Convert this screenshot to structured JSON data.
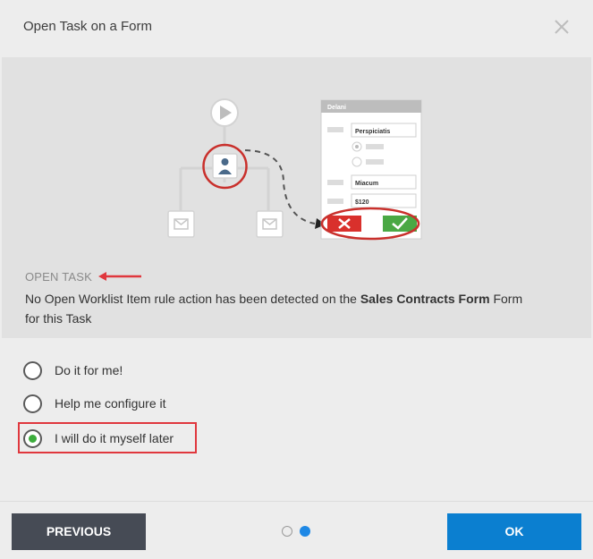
{
  "dialog": {
    "title": "Open Task on a Form"
  },
  "illustration": {
    "form_title": "Delani",
    "field1": "Perspiciatis",
    "field2": "Miacum",
    "field3": "$120"
  },
  "info": {
    "heading": "OPEN TASK",
    "desc_pre": "No Open Worklist Item rule action has been detected on the ",
    "desc_bold": "Sales Contracts Form",
    "desc_post": " Form for this Task"
  },
  "options": [
    {
      "label": "Do it for me!",
      "selected": false
    },
    {
      "label": "Help me configure it",
      "selected": false
    },
    {
      "label": "I will do it myself later",
      "selected": true
    }
  ],
  "footer": {
    "previous_label": "PREVIOUS",
    "ok_label": "OK",
    "page_count": 2,
    "current_page": 2
  },
  "colors": {
    "accent": "#0b7fd0",
    "selected_radio": "#3cad3c",
    "highlight": "#e0373d"
  }
}
